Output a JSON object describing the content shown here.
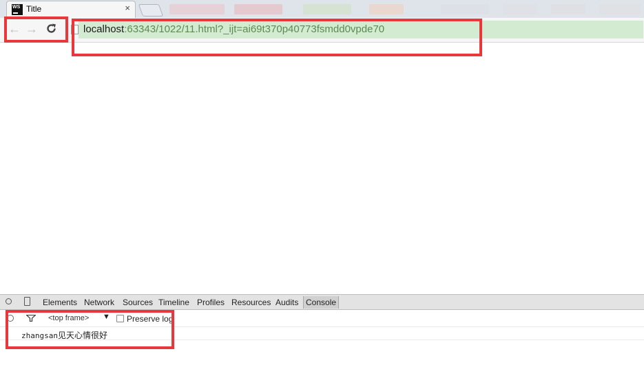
{
  "browser": {
    "tab": {
      "title": "Title",
      "close": "×",
      "logo_text": "WS"
    },
    "address": {
      "host": "localhost",
      "rest": ":63343/1022/11.html?_ijt=ai69t370p40773fsmdd0vpde70"
    },
    "nav": {
      "back_icon": "←",
      "forward_icon": "→",
      "reload_icon": "C"
    }
  },
  "devtools": {
    "tabs": [
      "Elements",
      "Network",
      "Sources",
      "Timeline",
      "Profiles",
      "Resources",
      "Audits",
      "Console"
    ],
    "active_tab": "Console",
    "console": {
      "frame_select": "<top frame>",
      "frame_arrow": "▼",
      "preserve_log_label": "Preserve log",
      "preserve_log_checked": false,
      "output_prefix": "zhangsan",
      "output_text": "见天心情很好"
    }
  },
  "annotation_color": "#e8383c"
}
